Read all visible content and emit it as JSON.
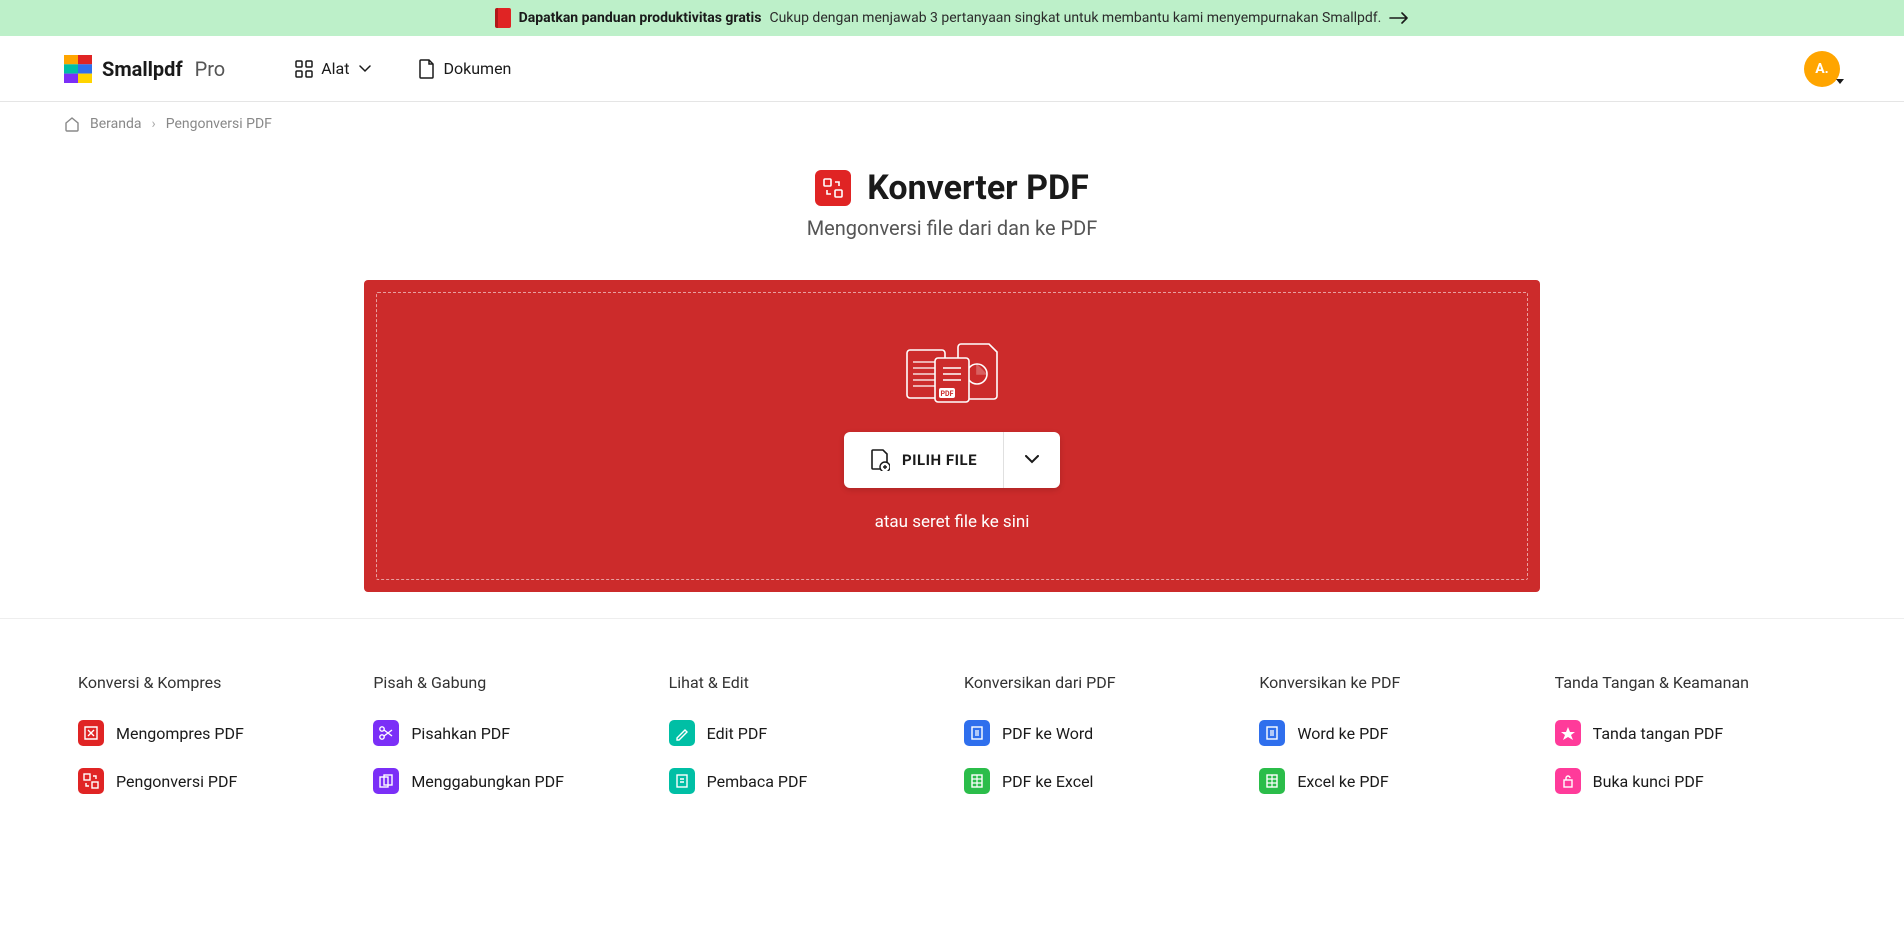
{
  "banner": {
    "bold": "Dapatkan panduan produktivitas gratis",
    "text": "Cukup dengan menjawab 3 pertanyaan singkat untuk membantu kami menyempurnakan Smallpdf."
  },
  "brand": {
    "name": "Smallpdf",
    "tier": "Pro"
  },
  "nav": {
    "tools": "Alat",
    "docs": "Dokumen"
  },
  "avatar": {
    "initials": "A."
  },
  "breadcrumb": {
    "home": "Beranda",
    "current": "Pengonversi PDF"
  },
  "page": {
    "title": "Konverter PDF",
    "subtitle": "Mengonversi file dari dan ke PDF"
  },
  "dropzone": {
    "button": "PILIH FILE",
    "drag": "atau seret file ke sini"
  },
  "columns": [
    {
      "title": "Konversi & Kompres",
      "links": [
        {
          "label": "Mengompres PDF",
          "color": "c-red",
          "icon": "compress"
        },
        {
          "label": "Pengonversi PDF",
          "color": "c-red",
          "icon": "convert"
        }
      ]
    },
    {
      "title": "Pisah & Gabung",
      "links": [
        {
          "label": "Pisahkan PDF",
          "color": "c-purple",
          "icon": "split"
        },
        {
          "label": "Menggabungkan PDF",
          "color": "c-purple",
          "icon": "merge"
        }
      ]
    },
    {
      "title": "Lihat & Edit",
      "links": [
        {
          "label": "Edit PDF",
          "color": "c-teal",
          "icon": "edit"
        },
        {
          "label": "Pembaca PDF",
          "color": "c-teal",
          "icon": "read"
        }
      ]
    },
    {
      "title": "Konversikan dari PDF",
      "links": [
        {
          "label": "PDF ke Word",
          "color": "c-blue",
          "icon": "doc"
        },
        {
          "label": "PDF ke Excel",
          "color": "c-green",
          "icon": "xls"
        }
      ]
    },
    {
      "title": "Konversikan ke PDF",
      "links": [
        {
          "label": "Word ke PDF",
          "color": "c-blue",
          "icon": "doc"
        },
        {
          "label": "Excel ke PDF",
          "color": "c-green",
          "icon": "xls"
        }
      ]
    },
    {
      "title": "Tanda Tangan & Keamanan",
      "links": [
        {
          "label": "Tanda tangan PDF",
          "color": "c-pink",
          "icon": "sign"
        },
        {
          "label": "Buka kunci PDF",
          "color": "c-pink",
          "icon": "unlock"
        }
      ]
    }
  ]
}
